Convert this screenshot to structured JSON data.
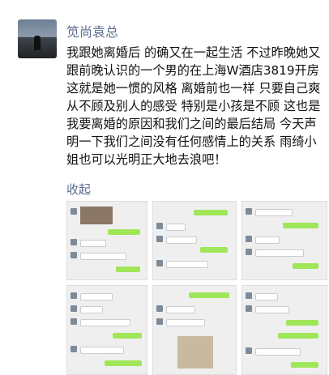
{
  "post": {
    "username": "笕尚袁总",
    "text": "我跟她离婚后 的确又在一起生活 不过昨晚她又跟前晚认识的一个男的在上海W酒店3819开房 这就是她一惯的风格 离婚前也一样 只要自己爽从不顾及别人的感受 特别是小孩是不顾 这也是我要离婚的原因和我们之间的最后结局 今天声明一下我们之间没有任何感情上的关系 雨绮小姐也可以光明正大地去浪吧！",
    "collapse_label": "收起"
  },
  "attachments": [
    {
      "name": "chat-screenshot-1"
    },
    {
      "name": "chat-screenshot-2"
    },
    {
      "name": "chat-screenshot-3"
    },
    {
      "name": "chat-screenshot-4"
    },
    {
      "name": "chat-screenshot-5"
    },
    {
      "name": "chat-screenshot-6"
    }
  ],
  "colors": {
    "link": "#5b6b8c",
    "bubble_self": "#9fe658",
    "bubble_other": "#ffffff"
  }
}
